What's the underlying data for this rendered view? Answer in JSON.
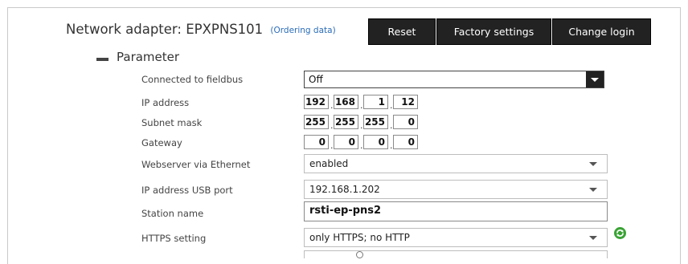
{
  "header": {
    "title": "Network adapter: EPXPNS101",
    "ordering_link": "(Ordering data)",
    "buttons": {
      "reset": "Reset",
      "factory": "Factory settings",
      "change_login": "Change login"
    }
  },
  "section": {
    "title": "Parameter"
  },
  "params": {
    "fieldbus": {
      "label": "Connected to fieldbus",
      "value": "Off"
    },
    "ip": {
      "label": "IP address",
      "octets": [
        "192",
        "168",
        "1",
        "12"
      ]
    },
    "subnet": {
      "label": "Subnet mask",
      "octets": [
        "255",
        "255",
        "255",
        "0"
      ]
    },
    "gateway": {
      "label": "Gateway",
      "octets": [
        "0",
        "0",
        "0",
        "0"
      ]
    },
    "webserver": {
      "label": "Webserver via Ethernet",
      "value": "enabled"
    },
    "usb_ip": {
      "label": "IP address USB port",
      "value": "192.168.1.202"
    },
    "station": {
      "label": "Station name",
      "value": "rsti-ep-pns2"
    },
    "https": {
      "label": "HTTPS setting",
      "value": "only HTTPS; no HTTP"
    }
  },
  "colors": {
    "accent_button": "#222222",
    "link": "#2a6cb8",
    "refresh_icon": "#3aa335"
  }
}
